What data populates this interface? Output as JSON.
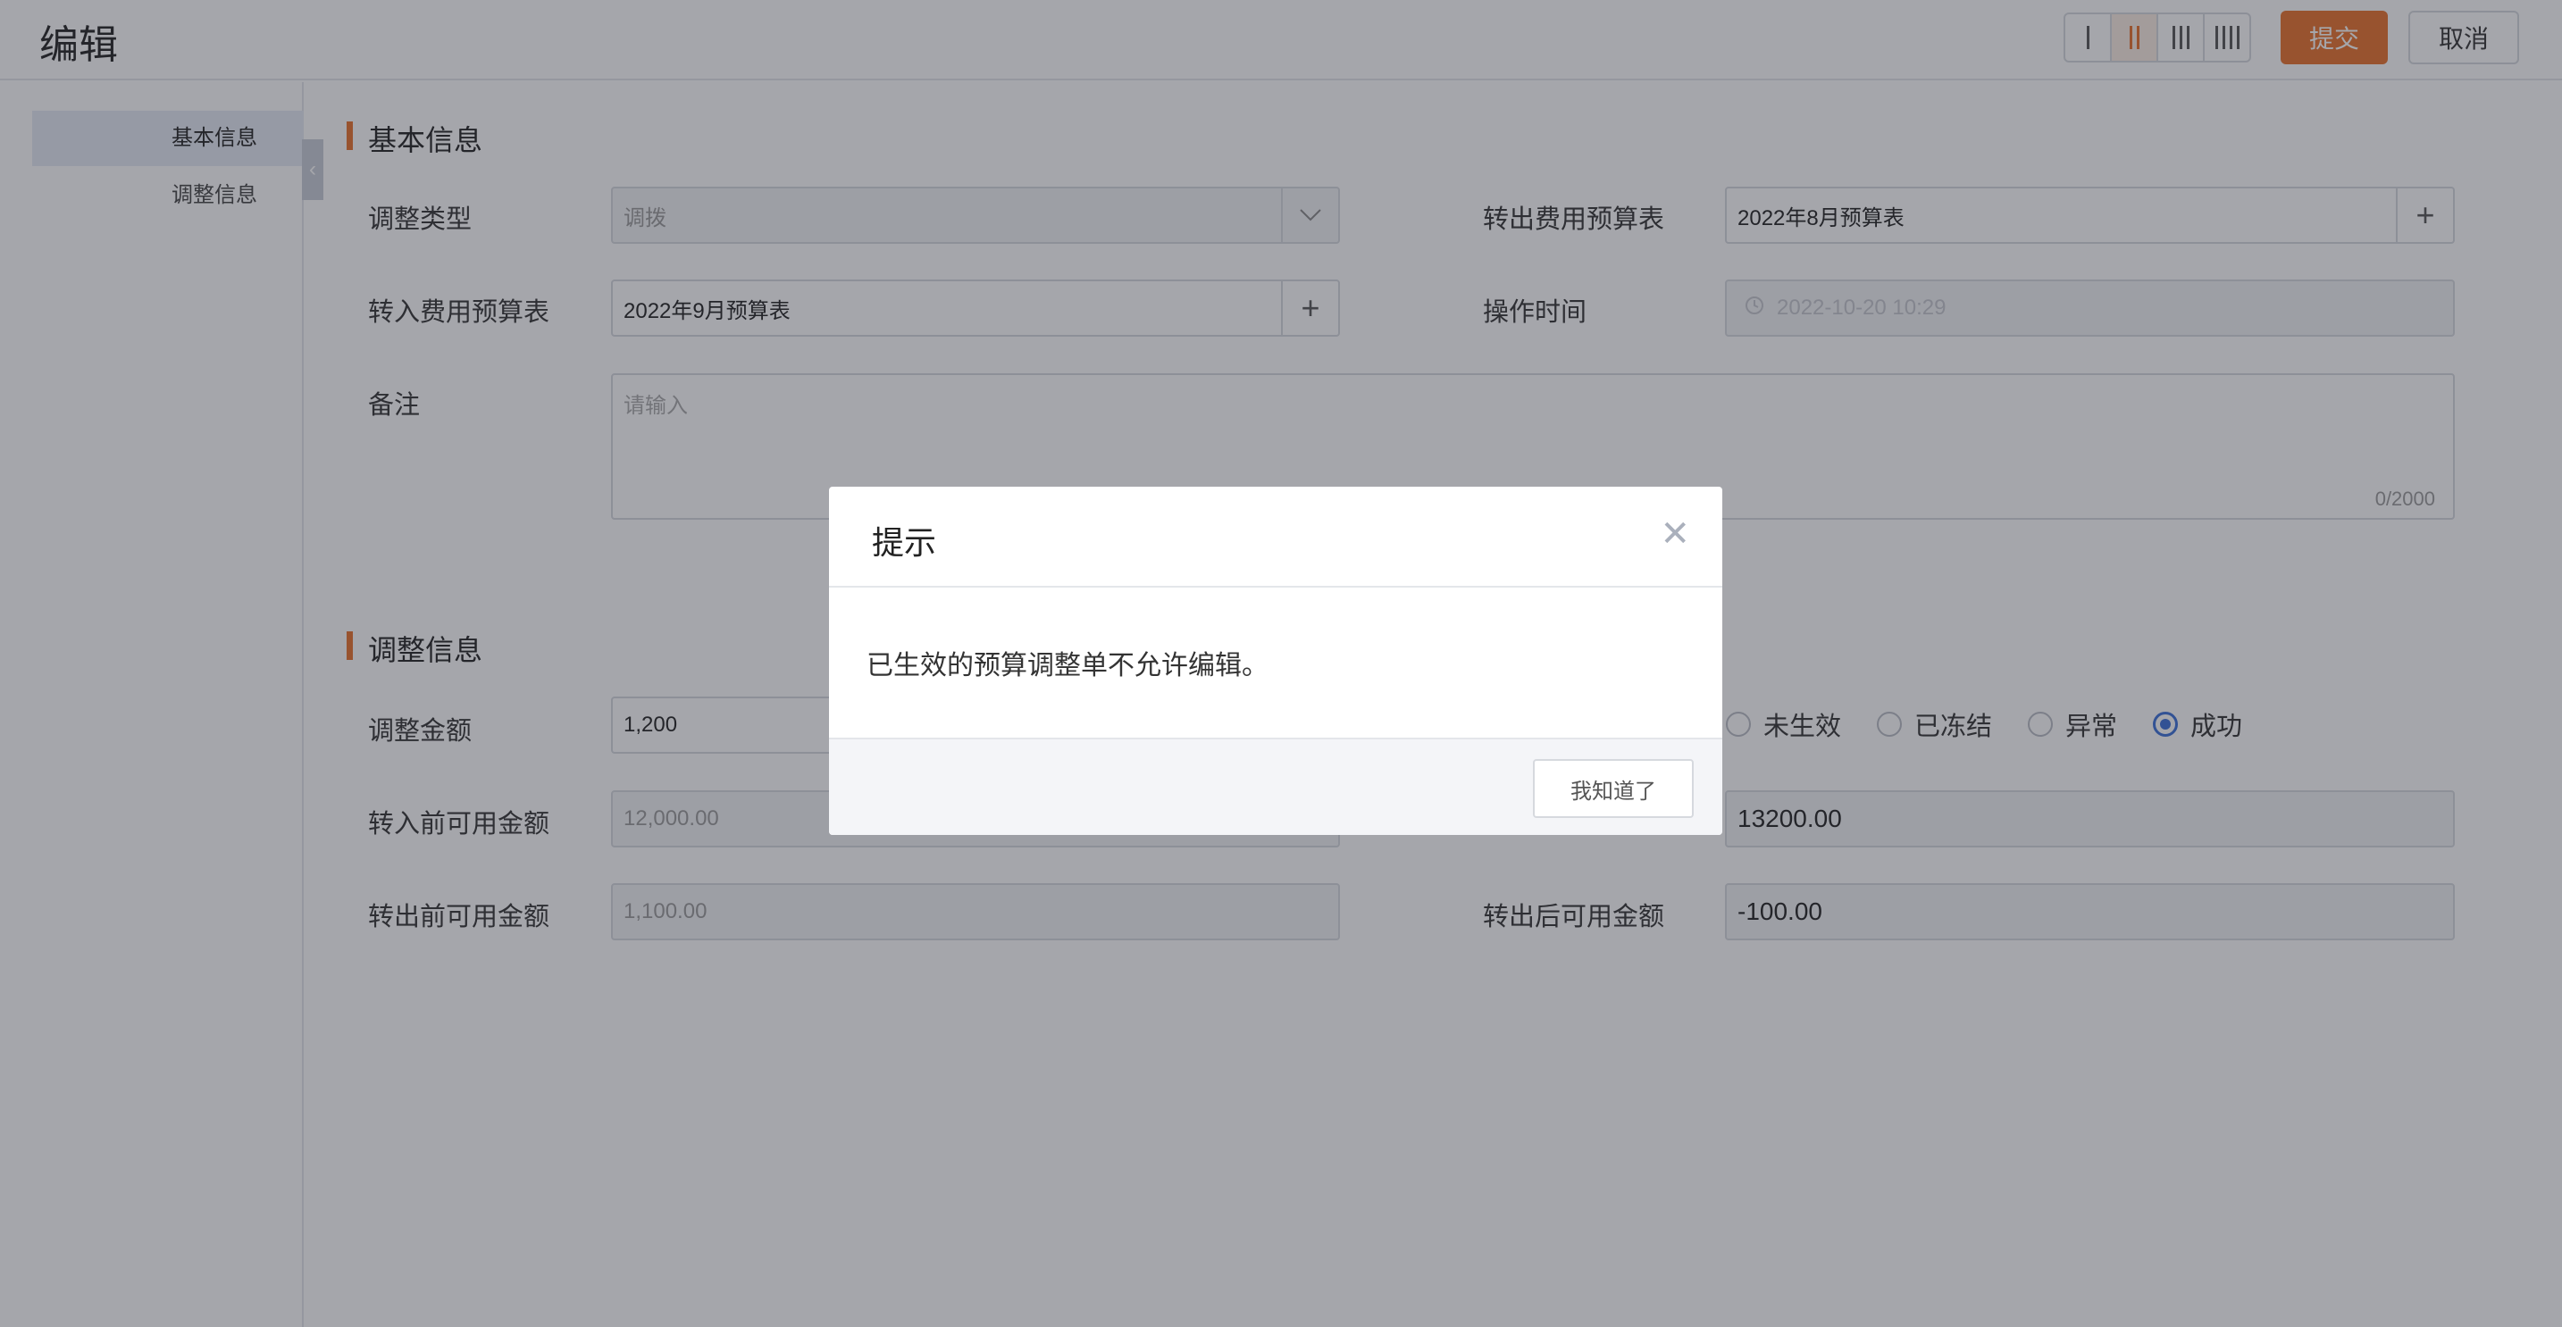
{
  "header": {
    "title": "编辑",
    "submit_label": "提交",
    "cancel_label": "取消"
  },
  "sidebar": {
    "items": [
      {
        "label": "基本信息",
        "active": true
      },
      {
        "label": "调整信息",
        "active": false
      }
    ]
  },
  "basic_info": {
    "section_title": "基本信息",
    "adjust_type": {
      "label": "调整类型",
      "value": "调拨"
    },
    "out_budget": {
      "label": "转出费用预算表",
      "value": "2022年8月预算表"
    },
    "in_budget": {
      "label": "转入费用预算表",
      "value": "2022年9月预算表"
    },
    "op_time": {
      "label": "操作时间",
      "value": "2022-10-20 10:29"
    },
    "remark": {
      "label": "备注",
      "placeholder": "请输入",
      "counter": "0/2000"
    }
  },
  "adjust_info": {
    "section_title": "调整信息",
    "amount": {
      "label": "调整金额",
      "value": "1,200"
    },
    "status_options": [
      {
        "label": "未生效",
        "checked": false
      },
      {
        "label": "已冻结",
        "checked": false
      },
      {
        "label": "异常",
        "checked": false
      },
      {
        "label": "成功",
        "checked": true
      }
    ],
    "in_before": {
      "label": "转入前可用金额",
      "value": "12,000.00"
    },
    "in_after": {
      "value": "13200.00"
    },
    "out_before": {
      "label": "转出前可用金额",
      "value": "1,100.00"
    },
    "out_after": {
      "label": "转出后可用金额",
      "value": "-100.00"
    }
  },
  "modal": {
    "title": "提示",
    "close_glyph": "✕",
    "message": "已生效的预算调整单不允许编辑。",
    "ok_label": "我知道了"
  },
  "colors": {
    "accent": "#e8712a",
    "radio_checked": "#3a6fd8"
  }
}
